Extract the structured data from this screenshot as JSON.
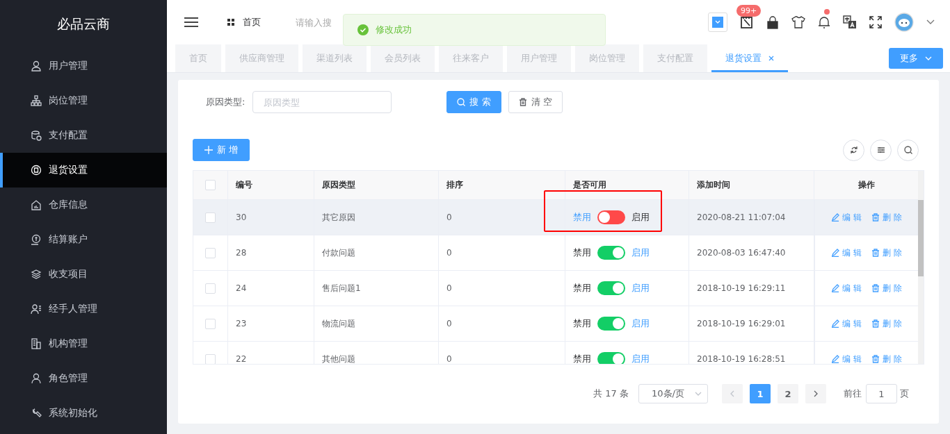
{
  "sidebar": {
    "logo": "必品云商",
    "items": [
      {
        "label": "用户管理",
        "selected": false
      },
      {
        "label": "岗位管理",
        "selected": false
      },
      {
        "label": "支付配置",
        "selected": false
      },
      {
        "label": "退货设置",
        "selected": true
      },
      {
        "label": "仓库信息",
        "selected": false
      },
      {
        "label": "结算账户",
        "selected": false
      },
      {
        "label": "收支项目",
        "selected": false
      },
      {
        "label": "经手人管理",
        "selected": false
      },
      {
        "label": "机构管理",
        "selected": false
      },
      {
        "label": "角色管理",
        "selected": false
      },
      {
        "label": "系统初始化",
        "selected": false
      }
    ]
  },
  "header": {
    "breadcrumb": "首页",
    "search": {
      "placeholder": "请输入搜"
    },
    "badge": "99+",
    "bell_dot": true
  },
  "toast": {
    "text": "修改成功"
  },
  "tabs": [
    {
      "label": "首页",
      "selected": false
    },
    {
      "label": "供应商管理",
      "selected": false
    },
    {
      "label": "渠道列表",
      "selected": false
    },
    {
      "label": "会员列表",
      "selected": false
    },
    {
      "label": "往来客户",
      "selected": false
    },
    {
      "label": "用户管理",
      "selected": false
    },
    {
      "label": "岗位管理",
      "selected": false
    },
    {
      "label": "支付配置",
      "selected": false
    },
    {
      "label": "退货设置",
      "selected": true
    }
  ],
  "tabs_more": "更多",
  "filter": {
    "label": "原因类型:",
    "placeholder": "原因类型",
    "search_button": "搜 索",
    "clear_button": "清 空"
  },
  "add_button": "新 增",
  "table": {
    "columns": [
      "编号",
      "原因类型",
      "排序",
      "是否可用",
      "添加时间",
      "操作"
    ],
    "select_all_checked": false,
    "rows": [
      {
        "checked": false,
        "id": "30",
        "reason": "其它原因",
        "sort": "0",
        "off_label": "禁用",
        "enabled": false,
        "on_label": "启用",
        "time": "2020-08-21 11:07:04",
        "edit": "编 辑",
        "delete": "删 除",
        "hovered": true,
        "highlighted": true
      },
      {
        "checked": false,
        "id": "28",
        "reason": "付款问题",
        "sort": "0",
        "off_label": "禁用",
        "enabled": true,
        "on_label": "启用",
        "time": "2020-08-03 16:47:40",
        "edit": "编 辑",
        "delete": "删 除",
        "hovered": false,
        "highlighted": false
      },
      {
        "checked": false,
        "id": "24",
        "reason": "售后问题1",
        "sort": "0",
        "off_label": "禁用",
        "enabled": true,
        "on_label": "启用",
        "time": "2018-10-19 16:29:11",
        "edit": "编 辑",
        "delete": "删 除",
        "hovered": false,
        "highlighted": false
      },
      {
        "checked": false,
        "id": "23",
        "reason": "物流问题",
        "sort": "0",
        "off_label": "禁用",
        "enabled": true,
        "on_label": "启用",
        "time": "2018-10-19 16:29:01",
        "edit": "编 辑",
        "delete": "删 除",
        "hovered": false,
        "highlighted": false
      },
      {
        "checked": false,
        "id": "22",
        "reason": "其他问题",
        "sort": "0",
        "off_label": "禁用",
        "enabled": true,
        "on_label": "启用",
        "time": "2018-10-19 16:28:51",
        "edit": "编 辑",
        "delete": "删 除",
        "hovered": false,
        "highlighted": false
      }
    ]
  },
  "pagination": {
    "total": "共 17 条",
    "page_size": "10条/页",
    "pages": [
      {
        "label": "1",
        "selected": true
      },
      {
        "label": "2",
        "selected": false
      }
    ],
    "goto_label": "前往",
    "goto_value": "1",
    "page_suffix": "页"
  }
}
